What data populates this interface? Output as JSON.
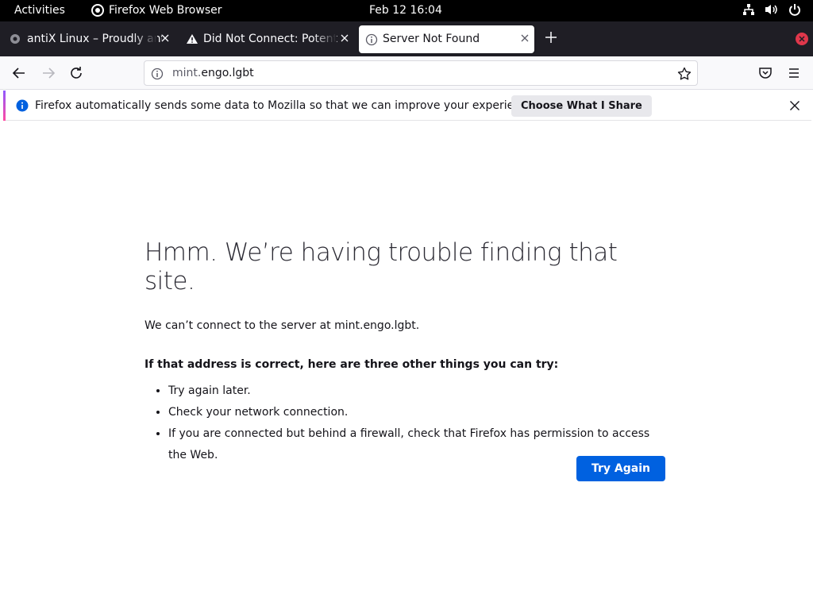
{
  "topbar": {
    "activities": "Activities",
    "app_name": "Firefox Web Browser",
    "clock": "Feb 12  16:04"
  },
  "tabs": [
    {
      "title": "antiX Linux – Proudly anti",
      "state": "inactive"
    },
    {
      "title": "Did Not Connect: Potenti",
      "state": "inactive"
    },
    {
      "title": "Server Not Found",
      "state": "active"
    }
  ],
  "urlbar": {
    "scheme_part": "mint.",
    "host_part": "engo.lgbt"
  },
  "notification": {
    "text": "Firefox automatically sends some data to Mozilla so that we can improve your experience.",
    "button": "Choose What I Share"
  },
  "error": {
    "title": "Hmm. We’re having trouble finding that site.",
    "description": "We can’t connect to the server at mint.engo.lgbt.",
    "suggestions_heading": "If that address is correct, here are three other things you can try:",
    "suggestions": [
      "Try again later.",
      "Check your network connection.",
      "If you are connected but behind a firewall, check that Firefox has permission to access the Web."
    ],
    "button": "Try Again"
  },
  "colors": {
    "accent_button": "#0061e0",
    "topbar": "#000000",
    "tabstrip": "#1f1e25",
    "close_red": "#e0374b"
  }
}
